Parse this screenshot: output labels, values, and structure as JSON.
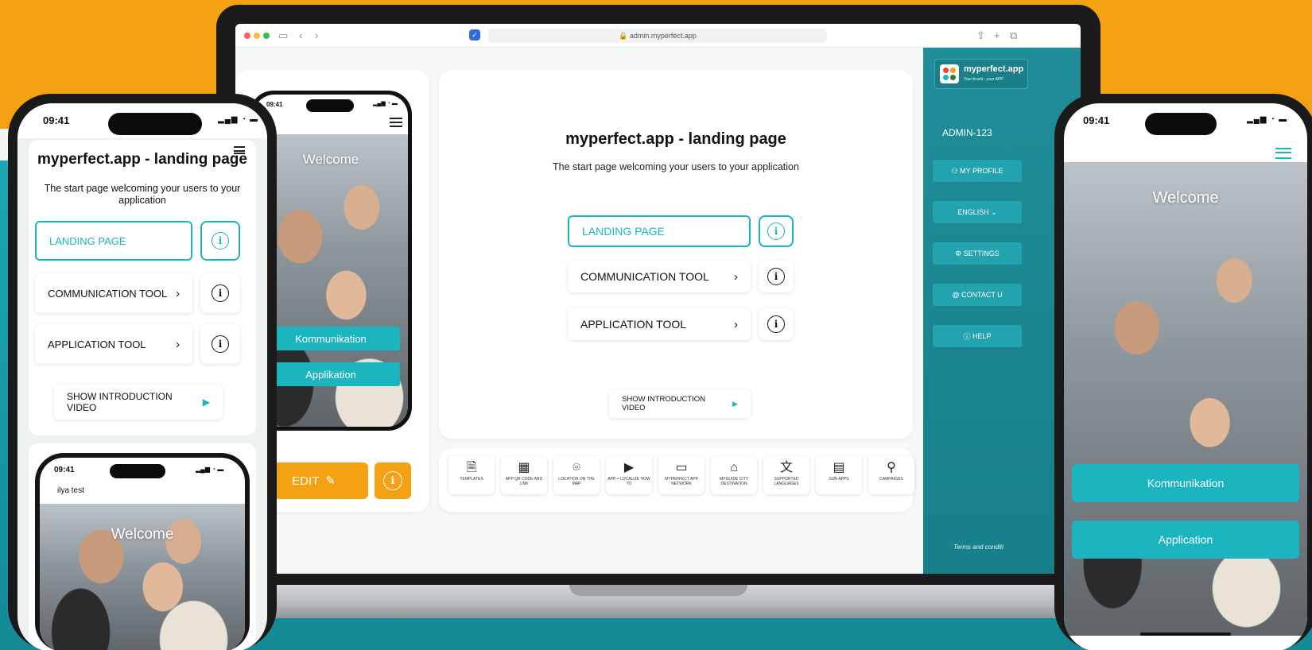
{
  "colors": {
    "orange": "#f5a114",
    "teal": "#1bb5c0",
    "teal_dark": "#177f89"
  },
  "browser": {
    "url": "admin.myperfect.app"
  },
  "admin": {
    "title": "myperfect.app - landing page",
    "subtitle": "The start page welcoming your users to your application",
    "landing_label": "LANDING PAGE",
    "communication_label": "COMMUNICATION TOOL",
    "application_label": "APPLICATION TOOL",
    "video_label": "SHOW INTRODUCTION VIDEO",
    "edit_label": "EDIT",
    "tools": [
      {
        "icon": "document-icon",
        "label": "TEMPLATES"
      },
      {
        "icon": "qr-code-icon",
        "label": "APP QR CODE AND LINK"
      },
      {
        "icon": "location-pin-icon",
        "label": "LOCATION ON THE MAP"
      },
      {
        "icon": "video-icon",
        "label": "APP + LOCALIZE HOW TO"
      },
      {
        "icon": "devices-icon",
        "label": "MYPERFECT APP NETWORK"
      },
      {
        "icon": "home-icon",
        "label": "MYGUIDE CITY DESTINATION"
      },
      {
        "icon": "translate-icon",
        "label": "SUPPORTED LANGUAGES"
      },
      {
        "icon": "layout-icon",
        "label": "SUB-APPS"
      },
      {
        "icon": "campaign-icon",
        "label": "CAMPAIGNS"
      }
    ],
    "sidebar": {
      "logo_text": "myperfect.app",
      "logo_tagline": "Your brand - your APP",
      "account": "ADMIN-123",
      "profile": "MY PROFILE",
      "language": "ENGLISH",
      "settings": "SETTINGS",
      "contact": "CONTACT U",
      "help": "HELP",
      "terms": "Terms and conditi"
    }
  },
  "phone_preview": {
    "time": "09:41",
    "welcome": "Welcome",
    "btn1": "Kommunikation",
    "btn2": "Applikation"
  },
  "phone_left": {
    "time": "09:41",
    "title": "myperfect.app - landing page",
    "subtitle": "The start page welcoming your users to your application",
    "landing_label": "LANDING PAGE",
    "communication_label": "COMMUNICATION TOOL",
    "application_label": "APPLICATION TOOL",
    "video_label": "SHOW INTRODUCTION VIDEO",
    "inner_time": "09:41",
    "inner_user": "ilya test",
    "inner_welcome": "Welcome"
  },
  "phone_right": {
    "time": "09:41",
    "welcome": "Welcome",
    "btn1": "Kommunikation",
    "btn2": "Application"
  }
}
